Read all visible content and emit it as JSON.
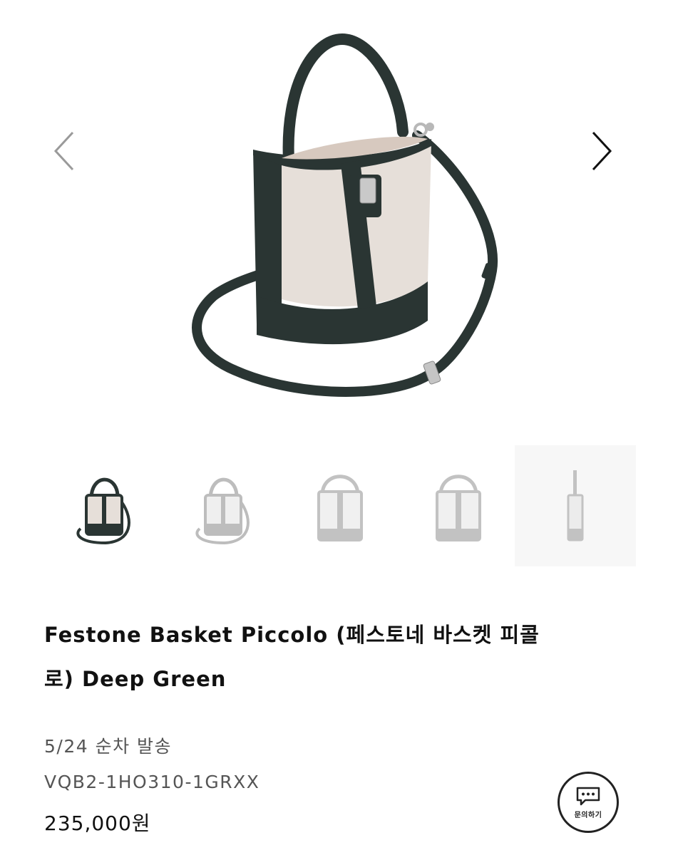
{
  "gallery": {
    "prev_icon": "chevron-left-icon",
    "next_icon": "chevron-right-icon",
    "thumbnails": [
      {
        "view": "bag-front-angled",
        "selected": true
      },
      {
        "view": "bag-front-angled-faded",
        "selected": false
      },
      {
        "view": "bag-front",
        "selected": false
      },
      {
        "view": "bag-back",
        "selected": false
      },
      {
        "view": "bag-side",
        "selected": false
      }
    ]
  },
  "product": {
    "title_line1": "Festone Basket Piccolo (페스토네 바스켓 피콜",
    "title_line2": "로) Deep Green",
    "shipping": "5/24 순차 발송",
    "sku": "VQB2-1HO310-1GRXX",
    "price": "235,000원"
  },
  "inquiry": {
    "label": "문의하기",
    "icon": "chat-bubble-icon"
  },
  "colors": {
    "bag_leather": "#2a3533",
    "bag_canvas": "#e6dfd9",
    "hardware": "#b8b8b8"
  }
}
